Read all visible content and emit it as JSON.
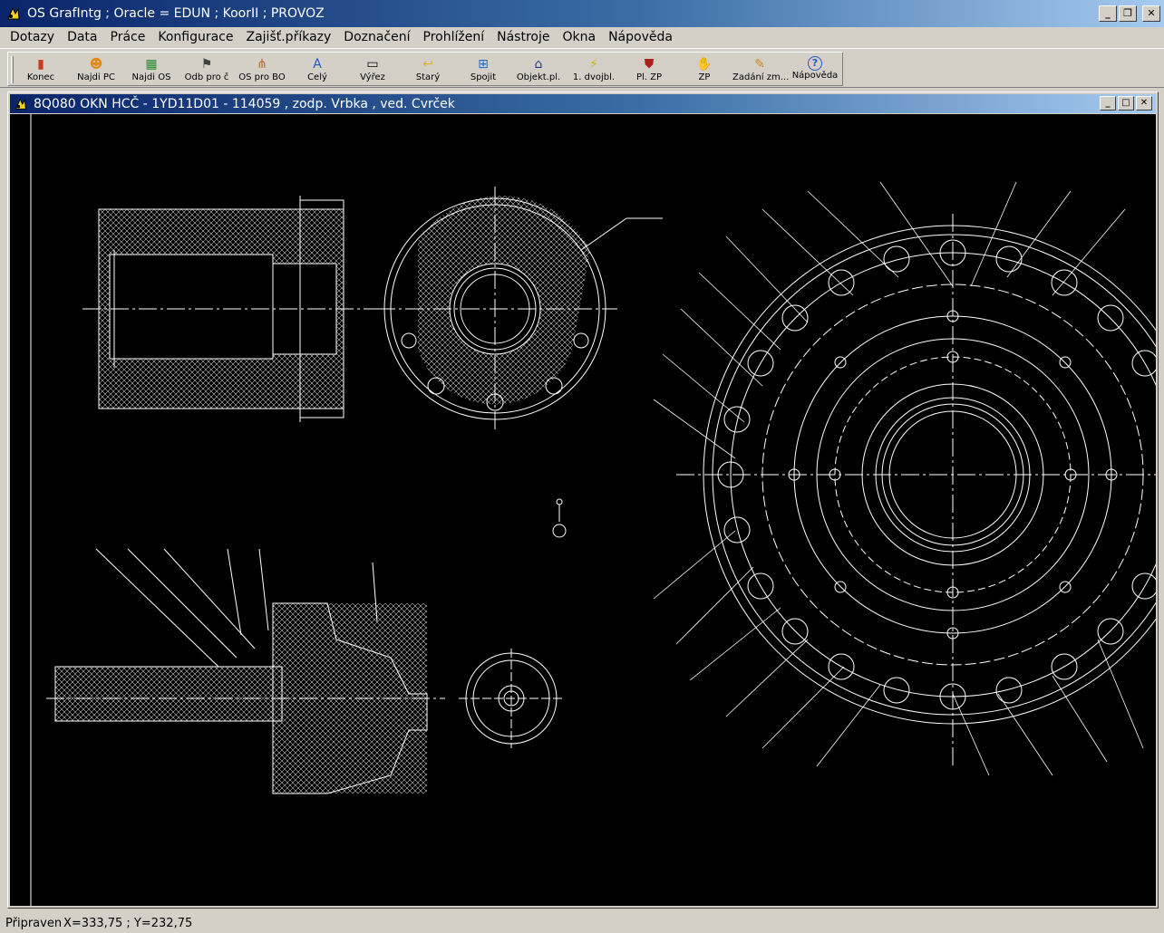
{
  "app": {
    "title": "OS GrafIntg ; Oracle = EDUN ; KoorII ; PROVOZ",
    "window_buttons": {
      "minimize": "_",
      "restore": "❐",
      "close": "✕"
    }
  },
  "menu": [
    {
      "label": "Dotazy"
    },
    {
      "label": "Data"
    },
    {
      "label": "Práce"
    },
    {
      "label": "Konfigurace"
    },
    {
      "label": "Zajišť.příkazy"
    },
    {
      "label": "Doznačení"
    },
    {
      "label": "Prohlížení"
    },
    {
      "label": "Nástroje"
    },
    {
      "label": "Okna"
    },
    {
      "label": "Nápověda"
    }
  ],
  "toolbar": [
    {
      "label": "Konec",
      "icon": "exit-door-icon",
      "glyph": "▮",
      "color": "#c83c1e"
    },
    {
      "label": "Najdi PC",
      "icon": "find-person-icon",
      "glyph": "☻",
      "color": "#e08a1e"
    },
    {
      "label": "Najdi OS",
      "icon": "find-grid-icon",
      "glyph": "▦",
      "color": "#2a8a2a"
    },
    {
      "label": "Odb pro č",
      "icon": "flag-icon",
      "glyph": "⚑",
      "color": "#404040"
    },
    {
      "label": "OS pro BO",
      "icon": "tree-icon",
      "glyph": "⋔",
      "color": "#b07020"
    },
    {
      "label": "Celý",
      "icon": "text-a-icon",
      "glyph": "A",
      "color": "#1e5ac8"
    },
    {
      "label": "Výřez",
      "icon": "rectangle-icon",
      "glyph": "▭",
      "color": "#000000"
    },
    {
      "label": "Starý",
      "icon": "undo-arrow-icon",
      "glyph": "↩",
      "color": "#e0b020"
    },
    {
      "label": "Spojit",
      "icon": "join-icon",
      "glyph": "⊞",
      "color": "#1e6ad4"
    },
    {
      "label": "Objekt.pl.",
      "icon": "building-icon",
      "glyph": "⌂",
      "color": "#1e3a8a"
    },
    {
      "label": "1. dvojbl.",
      "icon": "lightning-icon",
      "glyph": "⚡",
      "color": "#d4b400"
    },
    {
      "label": "Pl. ZP",
      "icon": "shield-icon",
      "glyph": "⛊",
      "color": "#b01e1e"
    },
    {
      "label": "ZP",
      "icon": "hand-icon",
      "glyph": "✋",
      "color": "#404040"
    },
    {
      "label": "Zadání zm...",
      "icon": "edit-pencil-icon",
      "glyph": "✎",
      "color": "#c88a1e"
    },
    {
      "label": "Nápověda",
      "icon": "help-icon",
      "glyph": "?",
      "color": "#1e5ac8"
    }
  ],
  "document_window": {
    "title": "8Q080 OKN HCČ - 1YD11D01  - 114059 , zodp. Vrbka , ved. Cvrček"
  },
  "status": {
    "ready": "Připraven",
    "coords": "X=333,75 ; Y=232,75"
  }
}
